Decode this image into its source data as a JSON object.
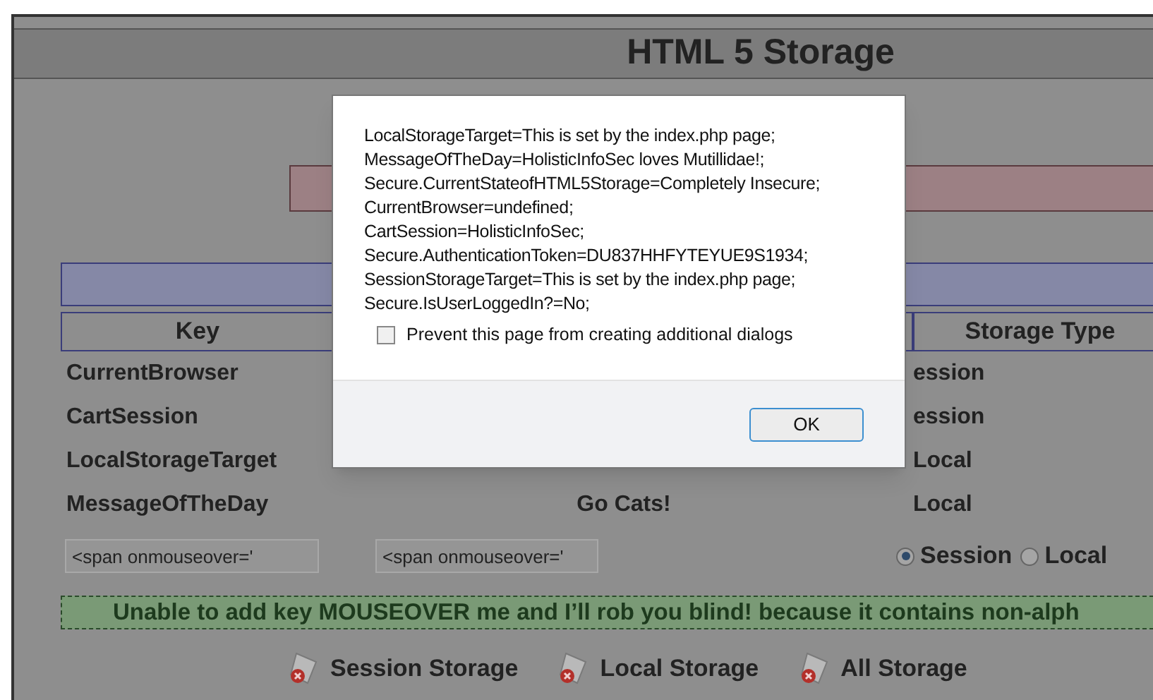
{
  "page": {
    "title": "HTML 5 Storage"
  },
  "table": {
    "columns": [
      "Key",
      "Storage Type"
    ],
    "rows": [
      {
        "key": "CurrentBrowser",
        "value": "",
        "storage_type": "ession"
      },
      {
        "key": "CartSession",
        "value": "",
        "storage_type": "ession"
      },
      {
        "key": "LocalStorageTarget",
        "value": "",
        "storage_type": "Local"
      },
      {
        "key": "MessageOfTheDay",
        "value": "Go Cats!",
        "storage_type": "Local"
      }
    ]
  },
  "form": {
    "key_field": {
      "value": "<span onmouseover='"
    },
    "value_field": {
      "value": "<span onmouseover='"
    },
    "storage_options": [
      {
        "label": "Session",
        "selected": true
      },
      {
        "label": "Local",
        "selected": false
      }
    ]
  },
  "message": "Unable to add key MOUSEOVER me and I’ll rob you blind! because it contains non-alph",
  "links": [
    "Session Storage",
    "Local Storage",
    "All Storage"
  ],
  "dialog": {
    "lines": [
      "LocalStorageTarget=This is set by the index.php page;",
      "MessageOfTheDay=HolisticInfoSec loves Mutillidae!;",
      "Secure.CurrentStateofHTML5Storage=Completely Insecure;",
      "CurrentBrowser=undefined;",
      "CartSession=HolisticInfoSec;",
      "Secure.AuthenticationToken=DU837HHFYTEYUE9S1934;",
      "SessionStorageTarget=This is set by the index.php page;",
      "Secure.IsUserLoggedIn?=No;"
    ],
    "checkbox": {
      "label": "Prevent this page from creating additional dialogs",
      "checked": false
    },
    "button": "OK"
  }
}
